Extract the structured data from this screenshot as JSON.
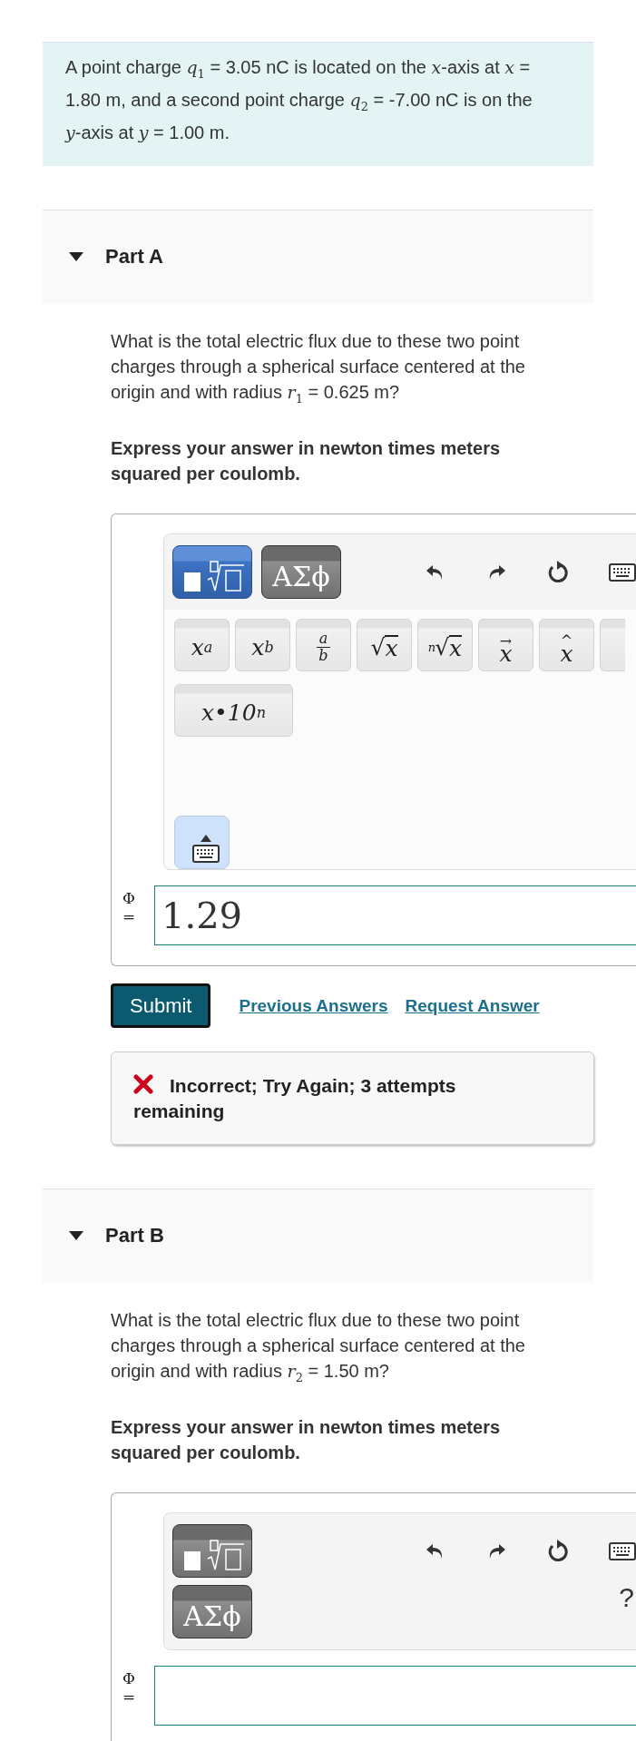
{
  "intro": "A point charge *q*$_{1}$ = 3.05 nC is located on the *x*-axis at *x* = 1.80 m, and a second point charge *q*$_{2}$ = -7.00 nC is on the *y*-axis at *y* = 1.00 m.",
  "parts": [
    {
      "title": "Part A",
      "expanded": true,
      "question": "What is the total electric flux due to these two point charges through a spherical surface centered at the origin and with radius *r*$_{1}$ = 0.625 m?",
      "instruction": "Express your answer in newton times meters squared per coulomb.",
      "answer": {
        "templates": [
          {
            "kind": "templates",
            "selected": true
          },
          {
            "kind": "symbols",
            "label": "ΑΣϕ",
            "selected": false
          }
        ],
        "palette": [
          {
            "kind": "sup",
            "base": "x",
            "script": "a"
          },
          {
            "kind": "sub",
            "base": "x",
            "script": "b"
          },
          {
            "kind": "frac",
            "num": "a",
            "den": "b"
          },
          {
            "kind": "sqrt",
            "sign": "√",
            "body": "x"
          },
          {
            "kind": "root",
            "index": "n",
            "sign": "√",
            "body": "x"
          },
          {
            "kind": "accent",
            "mark": "→",
            "body": "x"
          },
          {
            "kind": "accent",
            "mark": "^",
            "body": "x"
          },
          {
            "kind": "blank"
          },
          {
            "kind": "sup",
            "base": "x•10",
            "script": "n"
          }
        ],
        "label": "Φ =",
        "value": "1.29"
      },
      "submit": "Submit",
      "links": [
        "Previous Answers",
        "Request Answer"
      ],
      "feedback": {
        "kind": "incorrect",
        "text": "Incorrect; Try Again; 3 attempts remaining"
      }
    },
    {
      "title": "Part B",
      "expanded": true,
      "question": "What is the total electric flux due to these two point charges through a spherical surface centered at the origin and with radius *r*$_{2}$ = 1.50 m?",
      "instruction": "Express your answer in newton times meters squared per coulomb.",
      "answer": {
        "templates": [
          {
            "kind": "templates",
            "selected": false
          },
          {
            "kind": "symbols",
            "label": "ΑΣϕ",
            "selected": false
          }
        ],
        "help": "?",
        "label": "Φ ="
      }
    }
  ]
}
